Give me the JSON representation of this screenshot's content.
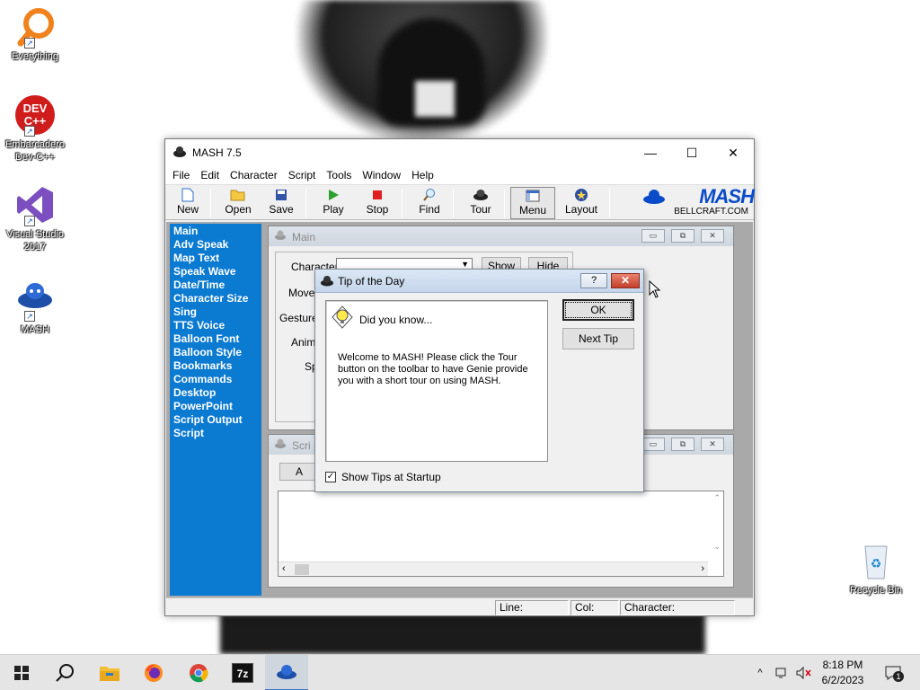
{
  "desktop": {
    "icons": [
      {
        "label": "Everything"
      },
      {
        "label": "Embarcadero Dev-C++"
      },
      {
        "label": "Visual Studio 2017"
      },
      {
        "label": "MASH"
      },
      {
        "label": "Recycle Bin"
      }
    ],
    "devcpp_icon_text": "DEV C++"
  },
  "window": {
    "title": "MASH 7.5",
    "menu": [
      "File",
      "Edit",
      "Character",
      "Script",
      "Tools",
      "Window",
      "Help"
    ],
    "toolbar": [
      "New",
      "Open",
      "Save",
      "Play",
      "Stop",
      "Find",
      "Tour",
      "Menu",
      "Layout"
    ],
    "brand": {
      "logo": "MASH",
      "url": "BELLCRAFT.COM"
    },
    "sidebar": [
      "Main",
      "Adv Speak",
      "Map Text",
      "Speak Wave",
      "Date/Time",
      "Character Size",
      "Sing",
      "TTS Voice",
      "Balloon Font",
      "Balloon Style",
      "Bookmarks",
      "Commands",
      "Desktop",
      "PowerPoint",
      "Script Output",
      "Script"
    ],
    "main_child": {
      "title": "Main",
      "character_label": "Character",
      "move_label": "Move",
      "gesture_label": "Gesture",
      "animate_label": "Anima",
      "speak_label": "Sp",
      "show_button": "Show",
      "hide_button": "Hide"
    },
    "script_child": {
      "title": "Scri",
      "partial_button": "A"
    },
    "statusbar": {
      "line_label": "Line:",
      "col_label": "Col:",
      "character_label": "Character:"
    }
  },
  "dialog": {
    "title": "Tip of the Day",
    "help_button": "?",
    "heading": "Did you know...",
    "body": "Welcome to MASH!  Please click the Tour button on the toolbar to have Genie provide you with a short tour on using MASH.",
    "ok_button": "OK",
    "next_button": "Next Tip",
    "show_tips_label": "Show Tips at Startup",
    "show_tips_checked": true
  },
  "taskbar": {
    "items": [
      "start-button",
      "search-button",
      "file-explorer",
      "firefox",
      "chrome",
      "7-zip",
      "mash"
    ],
    "time": "8:18 PM",
    "date": "6/2/2023",
    "notification_count": "1"
  }
}
